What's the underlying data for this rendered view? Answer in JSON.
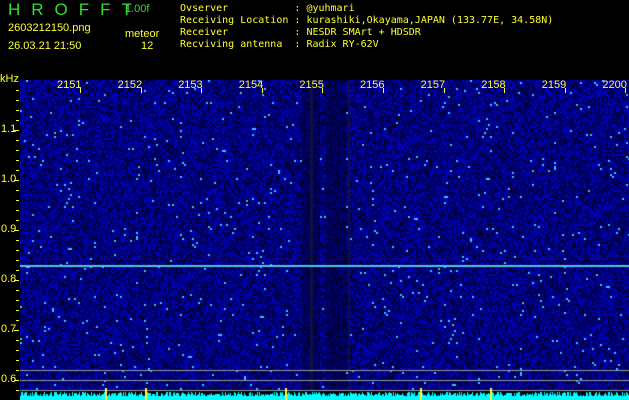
{
  "header": {
    "app_title": "HROFFT",
    "version": "1.00f",
    "filename": "2603212150.png",
    "datetime": "26.03.21 21:50",
    "meteor_label": "meteor",
    "meteor_count": "12"
  },
  "info": [
    {
      "label": "Ovserver          ",
      "value": "@yuhmari"
    },
    {
      "label": "Receiving Location",
      "value": "kurashiki,Okayama,JAPAN (133.77E, 34.58N)"
    },
    {
      "label": "Receiver          ",
      "value": "NESDR SMArt + HDSDR"
    },
    {
      "label": "Recviving antenna ",
      "value": "Radix RY-62V"
    }
  ],
  "axes": {
    "y_unit": "kHz",
    "y_ticks": [
      "1.1",
      "1.0",
      "0.9",
      "0.8",
      "0.7",
      "0.6"
    ],
    "x_ticks": [
      "2151",
      "2152",
      "2153",
      "2154",
      "2155",
      "2156",
      "2157",
      "2158",
      "2159",
      "2200"
    ]
  },
  "colors": {
    "text": "#ffff33",
    "title": "#33dd33",
    "spectrum": "#00ffff",
    "background": "#000000"
  }
}
